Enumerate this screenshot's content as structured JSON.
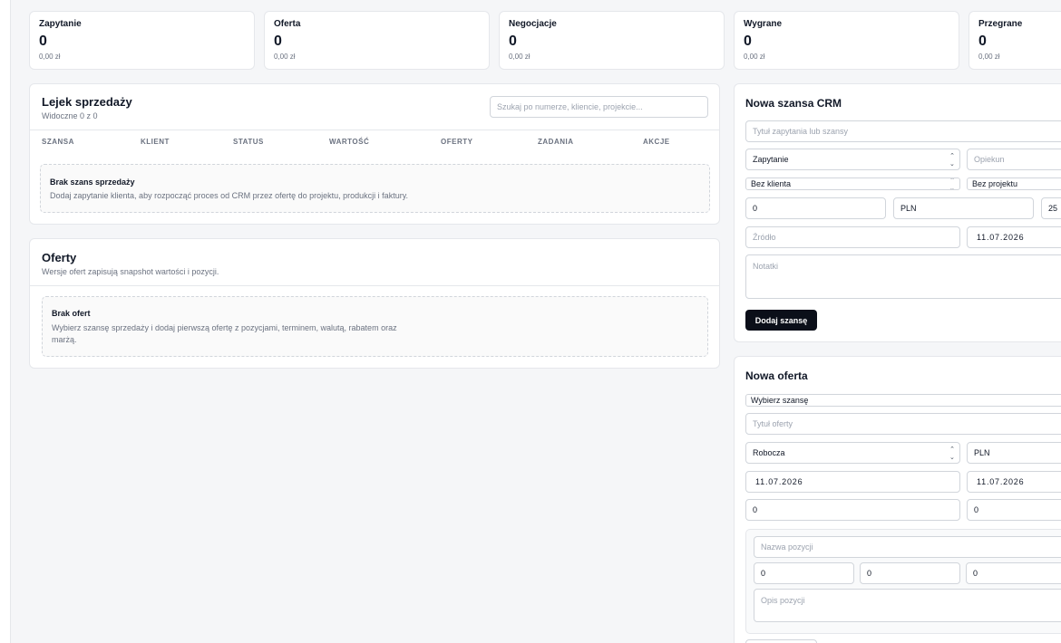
{
  "stats": [
    {
      "label": "Zapytanie",
      "count": "0",
      "amount": "0,00 zł"
    },
    {
      "label": "Oferta",
      "count": "0",
      "amount": "0,00 zł"
    },
    {
      "label": "Negocjacje",
      "count": "0",
      "amount": "0,00 zł"
    },
    {
      "label": "Wygrane",
      "count": "0",
      "amount": "0,00 zł"
    },
    {
      "label": "Przegrane",
      "count": "0",
      "amount": "0,00 zł"
    }
  ],
  "funnel": {
    "title": "Lejek sprzedaży",
    "subtitle": "Widoczne 0 z 0",
    "search_placeholder": "Szukaj po numerze, kliencie, projekcie...",
    "columns": [
      "SZANSA",
      "KLIENT",
      "STATUS",
      "WARTOŚĆ",
      "OFERTY",
      "ZADANIA",
      "AKCJE"
    ],
    "empty_title": "Brak szans sprzedaży",
    "empty_desc": "Dodaj zapytanie klienta, aby rozpocząć proces od CRM przez ofertę do projektu, produkcji i faktury."
  },
  "offers": {
    "title": "Oferty",
    "subtitle": "Wersje ofert zapisują snapshot wartości i pozycji.",
    "empty_title": "Brak ofert",
    "empty_desc": "Wybierz szansę sprzedaży i dodaj pierwszą ofertę z pozycjami, terminem, walutą, rabatem oraz marżą."
  },
  "new_opportunity": {
    "title": "Nowa szansa CRM",
    "title_placeholder": "Tytuł zapytania lub szansy",
    "stage": "Zapytanie",
    "owner_placeholder": "Opiekun",
    "client": "Bez klienta",
    "project": "Bez projektu",
    "value": "0",
    "currency": "PLN",
    "probability": "25",
    "source_placeholder": "Źródło",
    "date": "11.07.2026",
    "notes_placeholder": "Notatki",
    "submit": "Dodaj szansę"
  },
  "new_offer": {
    "title": "Nowa oferta",
    "opportunity": "Wybierz szansę",
    "title_placeholder": "Tytuł oferty",
    "status": "Robocza",
    "currency": "PLN",
    "date_from": "11.07.2026",
    "date_to": "11.07.2026",
    "discount": "0",
    "margin": "0",
    "item_name_placeholder": "Nazwa pozycji",
    "item_qty": "0",
    "item_price": "0",
    "item_vat": "0",
    "item_desc_placeholder": "Opis pozycji"
  }
}
